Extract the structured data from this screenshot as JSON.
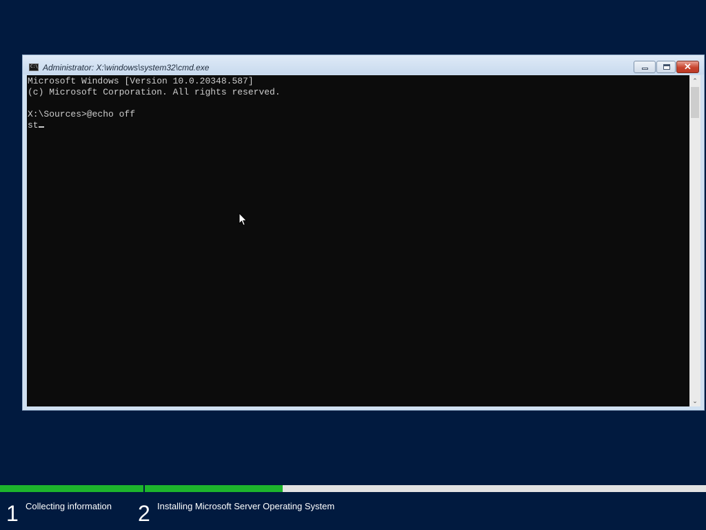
{
  "window": {
    "title": "Administrator: X:\\windows\\system32\\cmd.exe",
    "icon_text": "C:\\_",
    "minimize_icon": "minimize-icon",
    "maximize_icon": "maximize-icon",
    "close_icon": "close-icon",
    "close_glyph": "✕"
  },
  "console": {
    "lines": [
      "Microsoft Windows [Version 10.0.20348.587]",
      "(c) Microsoft Corporation. All rights reserved.",
      "",
      "X:\\Sources>@echo off"
    ],
    "current_input": "st",
    "foreground": "#cccccc",
    "background": "#0c0c0c"
  },
  "scrollbar": {
    "up_arrow": "⌃",
    "down_arrow": "⌄"
  },
  "setup": {
    "steps": [
      {
        "number": "1",
        "label": "Collecting information",
        "progress": 1.0
      },
      {
        "number": "2",
        "label": "Installing Microsoft Server Operating System",
        "progress": 0.246
      }
    ],
    "progress_color": "#1db52c",
    "background": "#011a3f"
  }
}
